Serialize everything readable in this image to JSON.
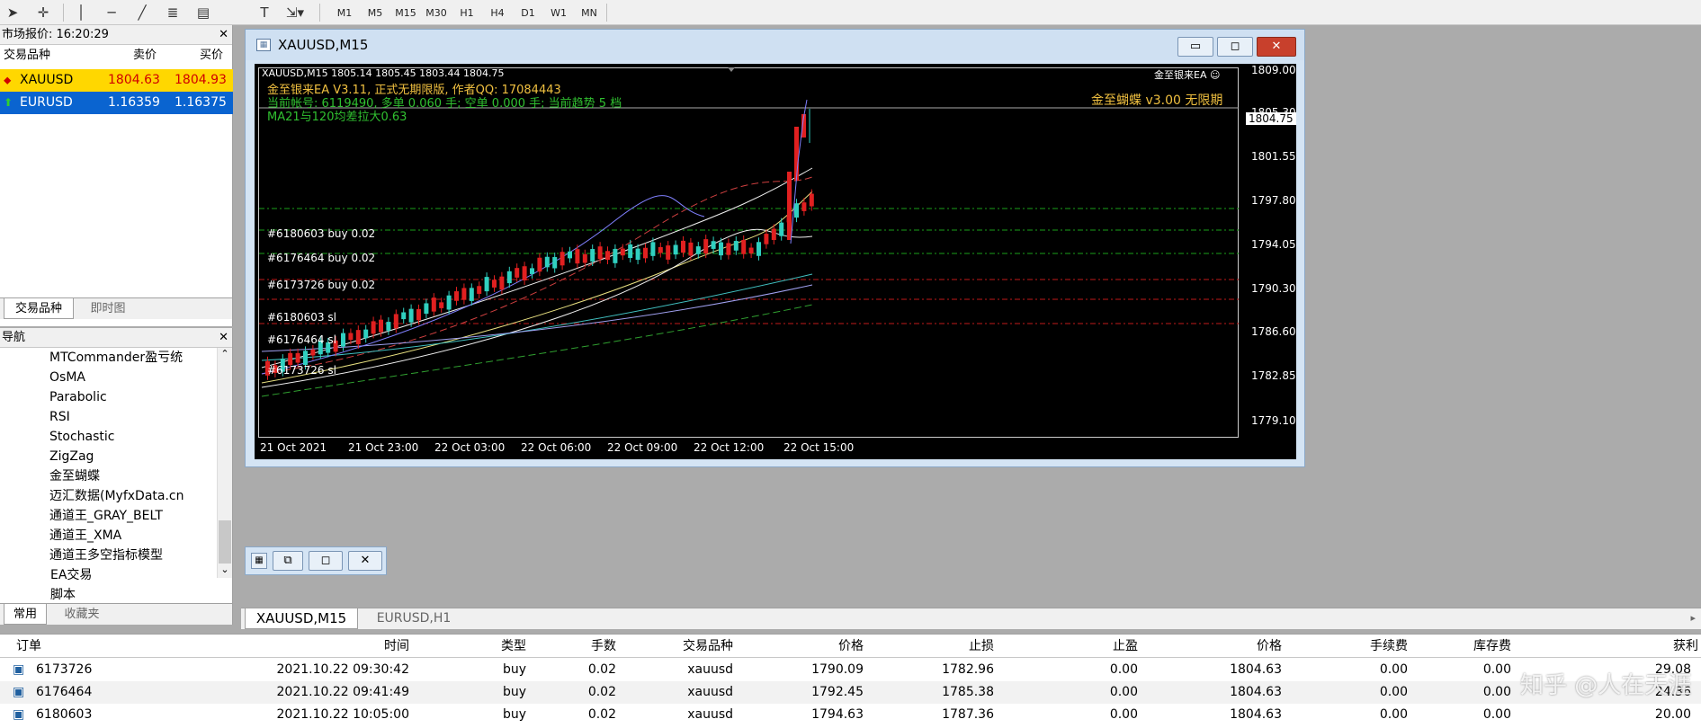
{
  "toolbar": {
    "timeframes": [
      "M1",
      "M5",
      "M15",
      "M30",
      "H1",
      "H4",
      "D1",
      "W1",
      "MN"
    ]
  },
  "market": {
    "title": "市场报价: 16:20:29",
    "col_symbol": "交易品种",
    "col_bid": "卖价",
    "col_ask": "买价",
    "rows": [
      {
        "symbol": "XAUUSD",
        "bid": "1804.63",
        "ask": "1804.93"
      },
      {
        "symbol": "EURUSD",
        "bid": "1.16359",
        "ask": "1.16375"
      }
    ],
    "tab_symbols": "交易品种",
    "tab_tick": "即时图"
  },
  "navigator": {
    "title": "导航",
    "items": [
      "MTCommander盈亏统",
      "OsMA",
      "Parabolic",
      "RSI",
      "Stochastic",
      "ZigZag",
      "金至蝴蝶",
      "迈汇数据(MyfxData.cn",
      "通道王_GRAY_BELT",
      "通道王_XMA",
      "通道王多空指标模型"
    ],
    "groups": [
      "EA交易",
      "脚本"
    ],
    "tab_common": "常用",
    "tab_favorites": "收藏夹"
  },
  "chart_window": {
    "title": "XAUUSD,M15"
  },
  "chart": {
    "header": "XAUUSD,M15  1805.14 1805.45 1803.44 1804.75",
    "ea_line1": "金至银来EA V3.11, 正式无期限版, 作者QQ: 17084443",
    "ea_line2": "当前帐号: 6119490, 多单 0.060 手; 空单 0.000 手; 当前趋势 5 档",
    "ea_line3": "MA21与120均差拉大0.63",
    "ea_name": "金至银来EA ☺",
    "indicator_name": "金至蝴蝶 v3.00 无限期",
    "order_labels": [
      "#6180603 buy 0.02",
      "#6176464 buy 0.02",
      "#6173726 buy 0.02",
      "#6180603 sl",
      "#6176464 sl",
      "#6173726 sl"
    ],
    "price_tag": "1804.75",
    "y_ticks": [
      "1809.00",
      "1805.30",
      "1801.55",
      "1797.80",
      "1794.05",
      "1790.30",
      "1786.60",
      "1782.85",
      "1779.10"
    ],
    "x_ticks": [
      "21 Oct 2021",
      "21 Oct 23:00",
      "22 Oct 03:00",
      "22 Oct 06:00",
      "22 Oct 09:00",
      "22 Oct 12:00",
      "22 Oct 15:00"
    ]
  },
  "chart_tabs": [
    "XAUUSD,M15",
    "EURUSD,H1"
  ],
  "terminal": {
    "headers": [
      "订单",
      "时间",
      "类型",
      "手数",
      "交易品种",
      "价格",
      "止损",
      "止盈",
      "价格",
      "手续费",
      "库存费",
      "获利"
    ],
    "rows": [
      [
        "6173726",
        "2021.10.22 09:30:42",
        "buy",
        "0.02",
        "xauusd",
        "1790.09",
        "1782.96",
        "0.00",
        "1804.63",
        "0.00",
        "0.00",
        "29.08"
      ],
      [
        "6176464",
        "2021.10.22 09:41:49",
        "buy",
        "0.02",
        "xauusd",
        "1792.45",
        "1785.38",
        "0.00",
        "1804.63",
        "0.00",
        "0.00",
        "24.36"
      ],
      [
        "6180603",
        "2021.10.22 10:05:00",
        "buy",
        "0.02",
        "xauusd",
        "1794.63",
        "1787.36",
        "0.00",
        "1804.63",
        "0.00",
        "0.00",
        "20.00"
      ]
    ],
    "watermark": "知乎 @人在天涯"
  }
}
